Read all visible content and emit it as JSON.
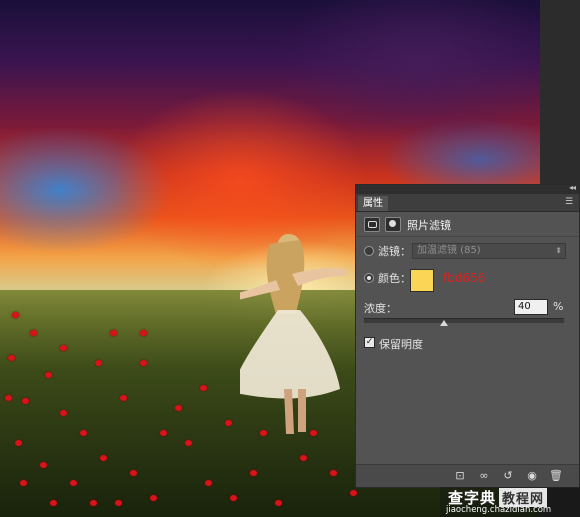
{
  "panel": {
    "tab_label": "属性",
    "collapse_glyph": "◂◂",
    "menu_glyph": "☰",
    "header_title": "照片滤镜",
    "filter_label": "滤镜：",
    "filter_value": "加温滤镜 (85)",
    "filter_selected": false,
    "color_label": "颜色：",
    "color_selected": true,
    "color_swatch": "#fbd656",
    "color_hex_annotation": "fbd656",
    "density_label": "浓度：",
    "density_value": "40",
    "density_unit": "%",
    "density_fraction": 0.4,
    "preserve_luminosity_label": "保留明度",
    "preserve_luminosity_checked": true,
    "toolbar_icons": [
      "clip-to-layer-icon",
      "view-previous-icon",
      "reset-icon",
      "visibility-eye-icon",
      "delete-trash-icon"
    ]
  },
  "watermark": {
    "site_name": "查字典",
    "tag": "教程网",
    "url": "jiaocheng.chazidian.com"
  }
}
